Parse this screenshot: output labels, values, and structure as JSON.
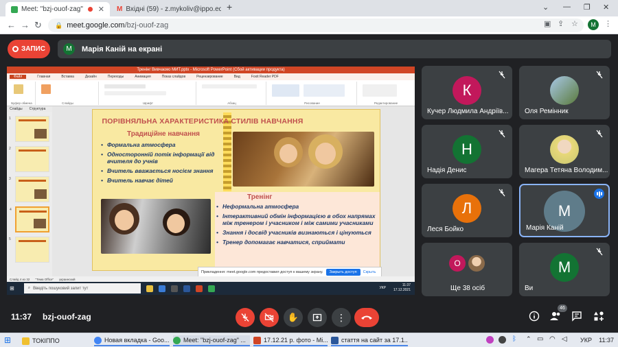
{
  "browser": {
    "tabs": [
      {
        "label": "Meet: \"bzj-ouof-zag\"",
        "active": true
      },
      {
        "label": "Вхідні (59) - z.mykoliv@ippo.edu",
        "active": false
      }
    ],
    "new_tab": "+",
    "url_host": "meet.google.com",
    "url_path": "/bzj-ouof-zag",
    "profile_initial": "M"
  },
  "meet": {
    "record_label": "ЗАПИС",
    "presenting_label": "Марія Каній на екрані",
    "presenter_initial": "M",
    "time": "11:37",
    "meeting_code": "bzj-ouof-zag",
    "people_count": "46",
    "participants": [
      {
        "name": "Кучер Людмила Андріїв...",
        "initial": "К",
        "color": "#c2185b",
        "muted": true
      },
      {
        "name": "Оля Ремінник",
        "initial": "",
        "color": "#7a9a5a",
        "muted": true,
        "photo": true
      },
      {
        "name": "Надія Денис",
        "initial": "Н",
        "color": "#137333",
        "muted": true
      },
      {
        "name": "Магера Тетяна Володим...",
        "initial": "",
        "color": "#e8d87a",
        "muted": true,
        "photo": true
      },
      {
        "name": "Леся Бойко",
        "initial": "Л",
        "color": "#e8710a",
        "muted": true
      },
      {
        "name": "Марія Каній",
        "initial": "M",
        "color": "#5f7c8a",
        "muted": false,
        "speaking": true
      },
      {
        "name": "Ще 38 осіб",
        "initial": "O",
        "color": "#c2185b",
        "muted": false,
        "more": true
      },
      {
        "name": "Ви",
        "initial": "M",
        "color": "#137333",
        "muted": true
      }
    ]
  },
  "shared_screen": {
    "ppt_title": "Тренінг Вивчаємо МИТ.pptx - Microsoft PowerPoint (Сбой активации продукта)",
    "ribbon_tabs": [
      "Файл",
      "Главная",
      "Вставка",
      "Дизайн",
      "Переходы",
      "Анимация",
      "Показ слайдов",
      "Рецензирование",
      "Вид",
      "Foxit Reader PDF"
    ],
    "ribbon_groups": [
      "Буфер обмена",
      "Слайды",
      "Шрифт",
      "Абзац",
      "Рисование",
      "Редактирование"
    ],
    "side_tabs": [
      "Слайды",
      "Структура"
    ],
    "slide": {
      "title": "ПОРІВНЯЛЬНА ХАРАКТЕРИСТИКА СТИЛІВ НАВЧАННЯ",
      "traditional_heading": "Традиційне    навчання",
      "traditional_items": [
        "Формальна атмосфера",
        "Односторонній потік інформації від вчителя до учнів",
        "Вчитель вважається носієм знання",
        "Вчитель навчає дітей"
      ],
      "training_heading": "Тренінг",
      "training_items": [
        "Неформальна атмосфера",
        "Інтерактивний обмін інформацією в обох напрямах між тренером і учасником і між самими учасниками",
        "Знання і досвід учасників визнаються і цінуються",
        "Тренер допомагає навчатися, сприймати"
      ]
    },
    "notification": {
      "text": "Прикладення: meet.google.com предоставил доступ к вашему экрану.",
      "button": "Закрыть доступ",
      "hide": "Скрыть"
    },
    "status_text": "Слайд 4 из 32",
    "theme_text": "\"Тема Office\"",
    "lang_text": "украинский",
    "win_search_placeholder": "Введіть пошуковий запит тут",
    "win_time": "11:37",
    "win_date": "17.12.2021",
    "win_lang": "УКР"
  },
  "host_taskbar": {
    "items": [
      {
        "label": "ТОКІППО",
        "color": "#f0c030"
      },
      {
        "label": "Новая вкладка - Goo...",
        "color": "#4285f4"
      },
      {
        "label": "Meet: \"bzj-ouof-zag\" ...",
        "color": "#34a853"
      },
      {
        "label": "17.12.21 р. фото - Мі...",
        "color": "#d04525"
      },
      {
        "label": "стаття на сайт за 17.1...",
        "color": "#2b579a"
      }
    ],
    "lang": "УКР",
    "time": "11:37"
  },
  "colors": {
    "meet_bg": "#202124",
    "tile_bg": "#3c4043",
    "red": "#ea4335",
    "slide_title": "#c0504d",
    "slide_text": "#1f3a68"
  }
}
